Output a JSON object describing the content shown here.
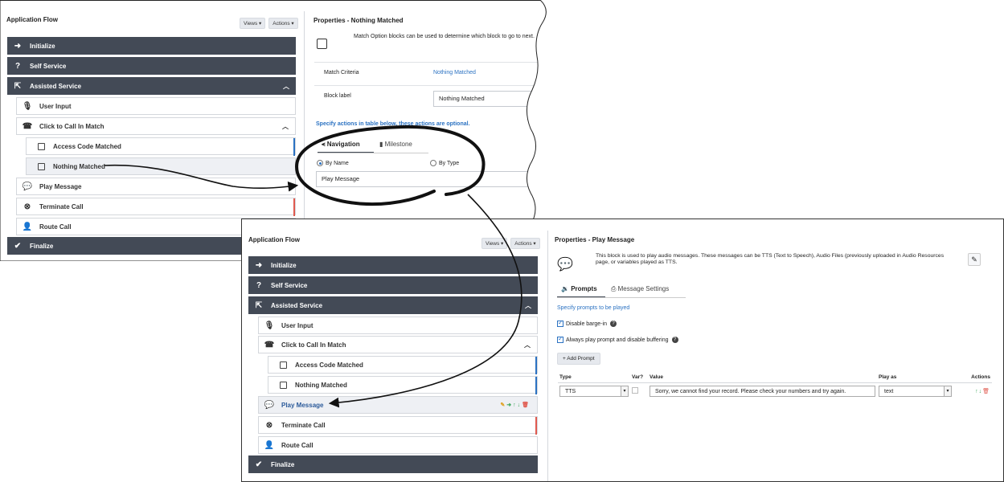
{
  "flow": {
    "title": "Application Flow",
    "views_label": "Views ▾",
    "actions_label": "Actions ▾",
    "items": {
      "initialize": "Initialize",
      "self_service": "Self Service",
      "assisted_service": "Assisted Service",
      "user_input": "User Input",
      "click_to_call": "Click to Call In Match",
      "access_code": "Access Code Matched",
      "nothing_matched": "Nothing Matched",
      "play_message": "Play Message",
      "terminate_call": "Terminate Call",
      "route_call": "Route Call",
      "finalize": "Finalize"
    }
  },
  "props_match": {
    "title": "Properties - Nothing Matched",
    "description": "Match Option blocks can be used to determine which block to go to next.",
    "match_criteria_label": "Match Criteria",
    "match_criteria_value": "Nothing Matched",
    "block_label_label": "Block label",
    "block_label_value": "Nothing Matched",
    "actions_note": "Specify actions in table below, these actions are optional.",
    "tab_navigation": "Navigation",
    "tab_milestone": "Milestone",
    "radio_by_name": "By Name",
    "radio_by_type": "By Type",
    "target_value": "Play Message"
  },
  "props_play": {
    "title": "Properties - Play Message",
    "description": "This block is used to play audio messages. These messages can be TTS (Text to Speech), Audio Files (previously uploaded in Audio Resources page, or variables played as TTS.",
    "tab_prompts": "Prompts",
    "tab_message_settings": "Message Settings",
    "specify_prompts": "Specify prompts to be played",
    "disable_barge_in": "Disable barge-in",
    "always_play": "Always play prompt and disable buffering",
    "add_prompt": "+ Add Prompt",
    "table": {
      "headers": [
        "Type",
        "Var?",
        "Value",
        "Play as",
        "Actions"
      ],
      "row": {
        "type": "TTS",
        "value": "Sorry, we cannot find your record.  Please check your numbers and try again.",
        "play_as": "text"
      }
    }
  },
  "colors": {
    "dark_row": "#434a56",
    "accent_blue": "#2b72c2",
    "accent_red": "#e05a4f"
  }
}
